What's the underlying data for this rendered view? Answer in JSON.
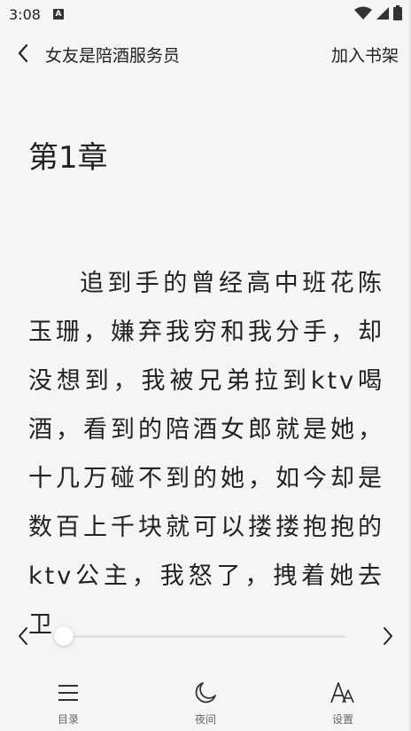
{
  "status_bar": {
    "time": "3:08",
    "notification_icon_letter": "A"
  },
  "header": {
    "title": "女友是陪酒服务员",
    "add_to_shelf": "加入书架"
  },
  "chapter": {
    "title": "第1章",
    "text": "追到手的曾经高中班花陈玉珊，嫌弃我穷和我分手，却没想到，我被兄弟拉到ktv喝酒，看到的陪酒女郎就是她，十几万碰不到的她，如今却是数百上千块就可以搂搂抱抱的ktv公主，我怒了，拽着她去卫"
  },
  "progress": {
    "value": 0.0
  },
  "toolbar": {
    "catalog_label": "目录",
    "night_label": "夜间",
    "settings_label": "设置"
  },
  "icons": {
    "back": "chevron-left-icon",
    "prev": "chevron-left-icon",
    "next": "chevron-right-icon",
    "catalog": "menu-icon",
    "night": "moon-icon",
    "settings": "font-size-icon",
    "wifi": "wifi-icon",
    "signal": "signal-icon",
    "battery": "battery-icon"
  }
}
